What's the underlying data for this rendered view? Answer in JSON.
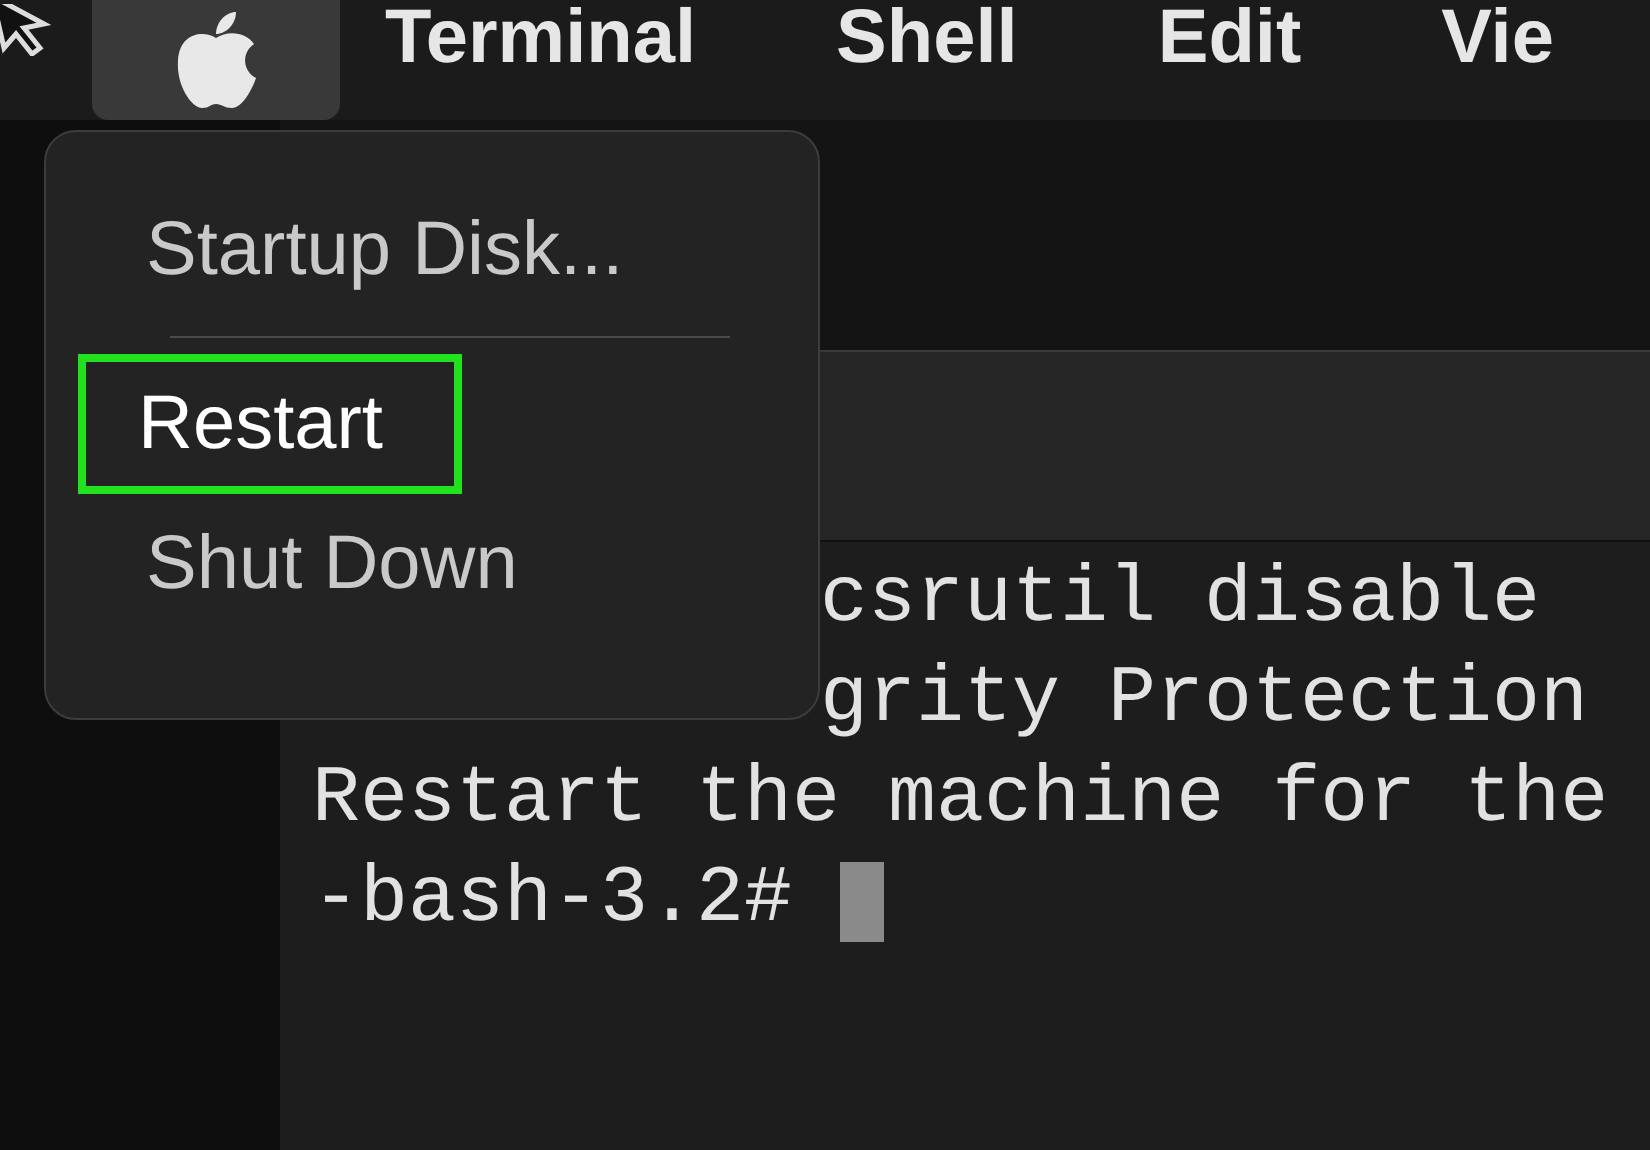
{
  "menu_bar": {
    "items": [
      {
        "kind": "apple",
        "selected": true
      },
      {
        "kind": "text",
        "label": "Terminal",
        "selected": false
      },
      {
        "kind": "text",
        "label": "Shell",
        "selected": false
      },
      {
        "kind": "text",
        "label": "Edit",
        "selected": false
      },
      {
        "kind": "text",
        "label": "Vie",
        "selected": false
      }
    ]
  },
  "apple_menu": {
    "items": [
      {
        "kind": "item",
        "label": "Startup Disk...",
        "annotated": false
      },
      {
        "kind": "separator"
      },
      {
        "kind": "item",
        "label": "Restart",
        "annotated": true
      },
      {
        "kind": "item",
        "label": "Shut Down",
        "annotated": false
      }
    ]
  },
  "terminal": {
    "lines": [
      {
        "kind": "covered",
        "text": "csrutil disable"
      },
      {
        "kind": "covered",
        "text": "grity Protection"
      },
      {
        "kind": "full",
        "text": "Restart the machine for the"
      },
      {
        "kind": "prompt",
        "text": "-bash-3.2#"
      }
    ]
  }
}
